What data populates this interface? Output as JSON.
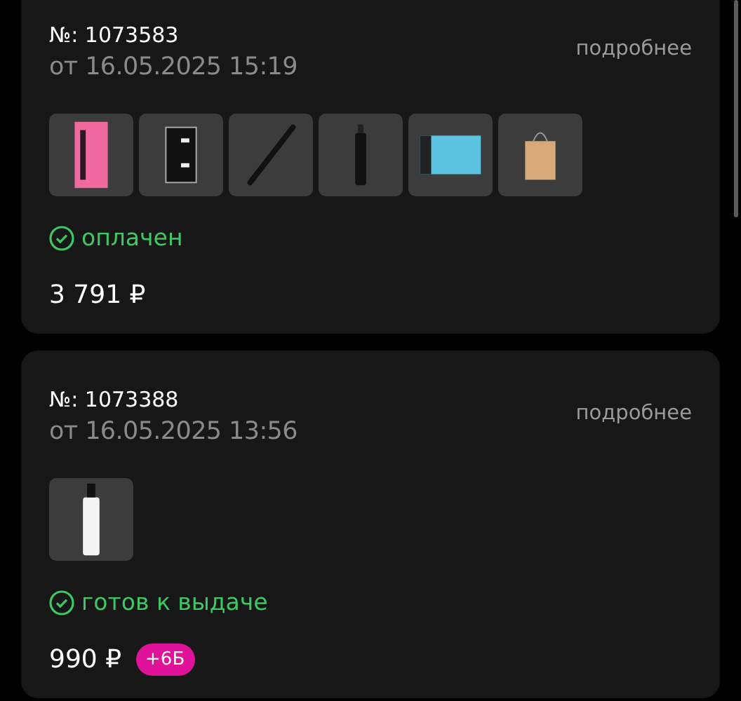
{
  "orders": [
    {
      "number": "№: 1073583",
      "date": "от 16.05.2025 15:19",
      "details": "подробнее",
      "items": [
        {
          "kind": "pink-box"
        },
        {
          "kind": "book"
        },
        {
          "kind": "pen"
        },
        {
          "kind": "spray"
        },
        {
          "kind": "blue-box"
        },
        {
          "kind": "bag"
        }
      ],
      "status": "оплачен",
      "price": "3 791 ₽"
    },
    {
      "number": "№: 1073388",
      "date": "от 16.05.2025 13:56",
      "details": "подробнее",
      "items": [
        {
          "kind": "bottle"
        }
      ],
      "status": "готов к выдаче",
      "price": "990 ₽",
      "bonus": "+6Б"
    }
  ]
}
